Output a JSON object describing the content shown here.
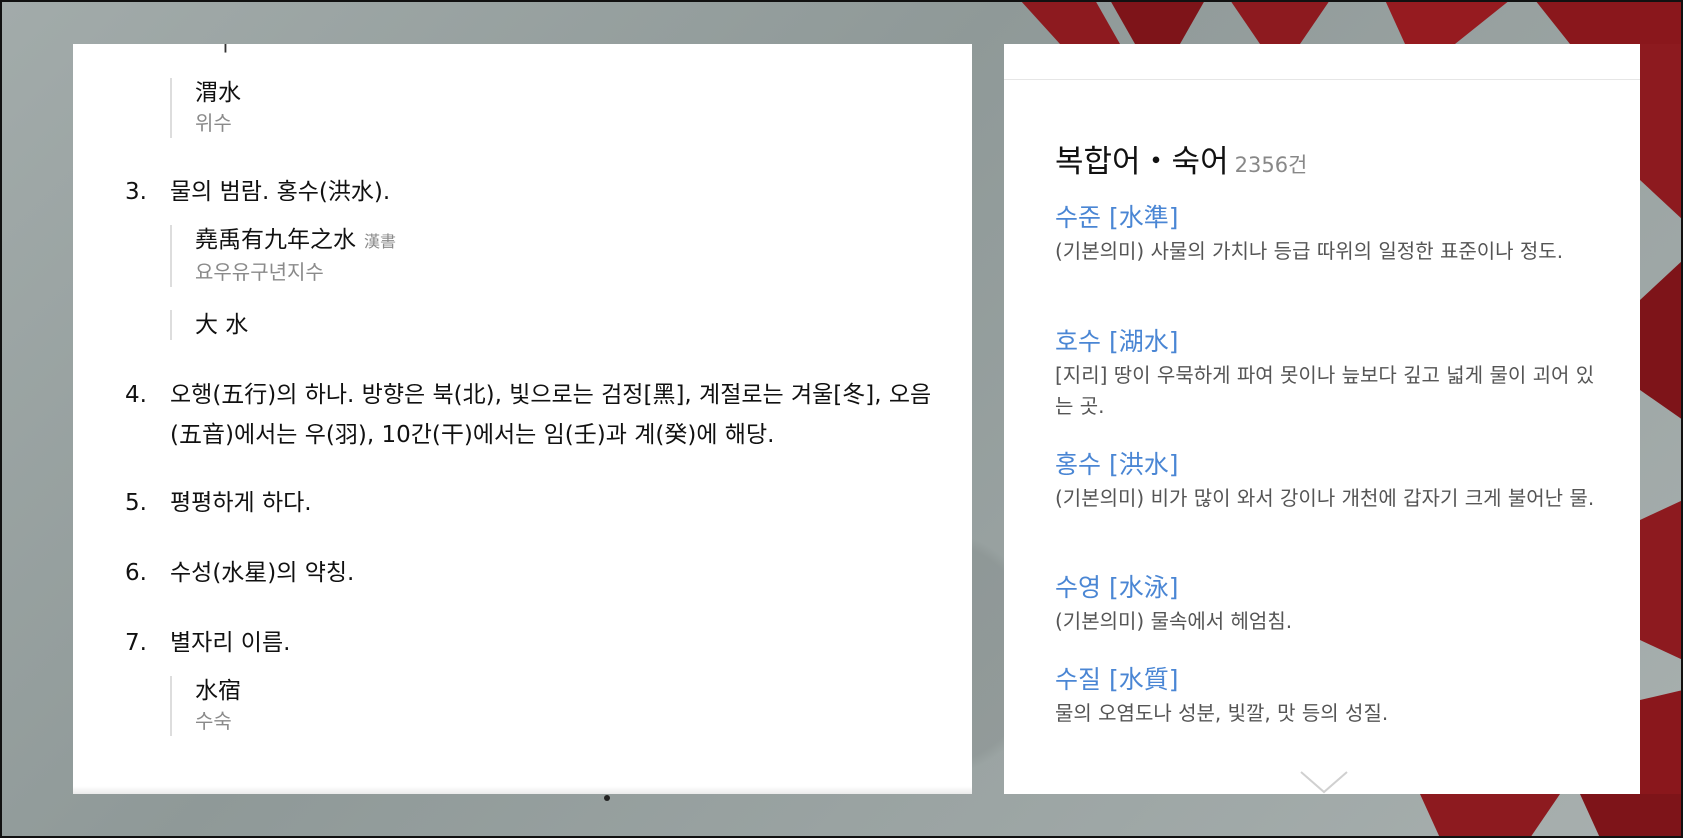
{
  "left_panel": {
    "clipped_example_text": "ㅡㅣ",
    "examples_top": [
      {
        "text": "渭水",
        "reading": "위수"
      }
    ],
    "definitions": [
      {
        "num": "3.",
        "text": "물의 범람. 홍수(洪水)."
      },
      {
        "num": "4.",
        "text": "오행(五行)의 하나. 방향은 북(北), 빛으로는 검정[黑], 계절로는 겨울[冬], 오음(五音)에서는 우(羽), 10간(干)에서는 임(壬)과 계(癸)에 해당."
      },
      {
        "num": "5.",
        "text": "평평하게 하다."
      },
      {
        "num": "6.",
        "text": "수성(水星)의 약칭."
      },
      {
        "num": "7.",
        "text": "별자리 이름."
      }
    ],
    "examples_def3": [
      {
        "text": "堯禹有九年之水",
        "source": "漢書",
        "reading": "요우유구년지수"
      },
      {
        "text": "大 水"
      }
    ],
    "examples_def7": [
      {
        "text": "水宿",
        "reading": "수숙"
      }
    ]
  },
  "right_panel": {
    "section_title": "복합어・숙어",
    "count": "2356건",
    "entries": [
      {
        "term": "수준 [水準]",
        "definition": "(기본의미) 사물의 가치나 등급 따위의 일정한 표준이나 정도."
      },
      {
        "term": "호수 [湖水]",
        "definition": "[지리] 땅이 우묵하게 파여 못이나 늪보다 깊고 넓게 물이 괴어 있는 곳."
      },
      {
        "term": "홍수 [洪水]",
        "definition": "(기본의미) 비가 많이 와서 강이나 개천에 갑자기 크게 불어난 물."
      },
      {
        "term": "수영 [水泳]",
        "definition": "(기본의미) 물속에서 헤엄침."
      },
      {
        "term": "수질 [水質]",
        "definition": "물의 오염도나 성분, 빛깔, 맛 등의 성질."
      }
    ],
    "more_icon": "chevron-down-icon"
  },
  "colors": {
    "link": "#4a86d4",
    "muted": "#8a8a8a",
    "background_accent": "#8d1a1f"
  }
}
